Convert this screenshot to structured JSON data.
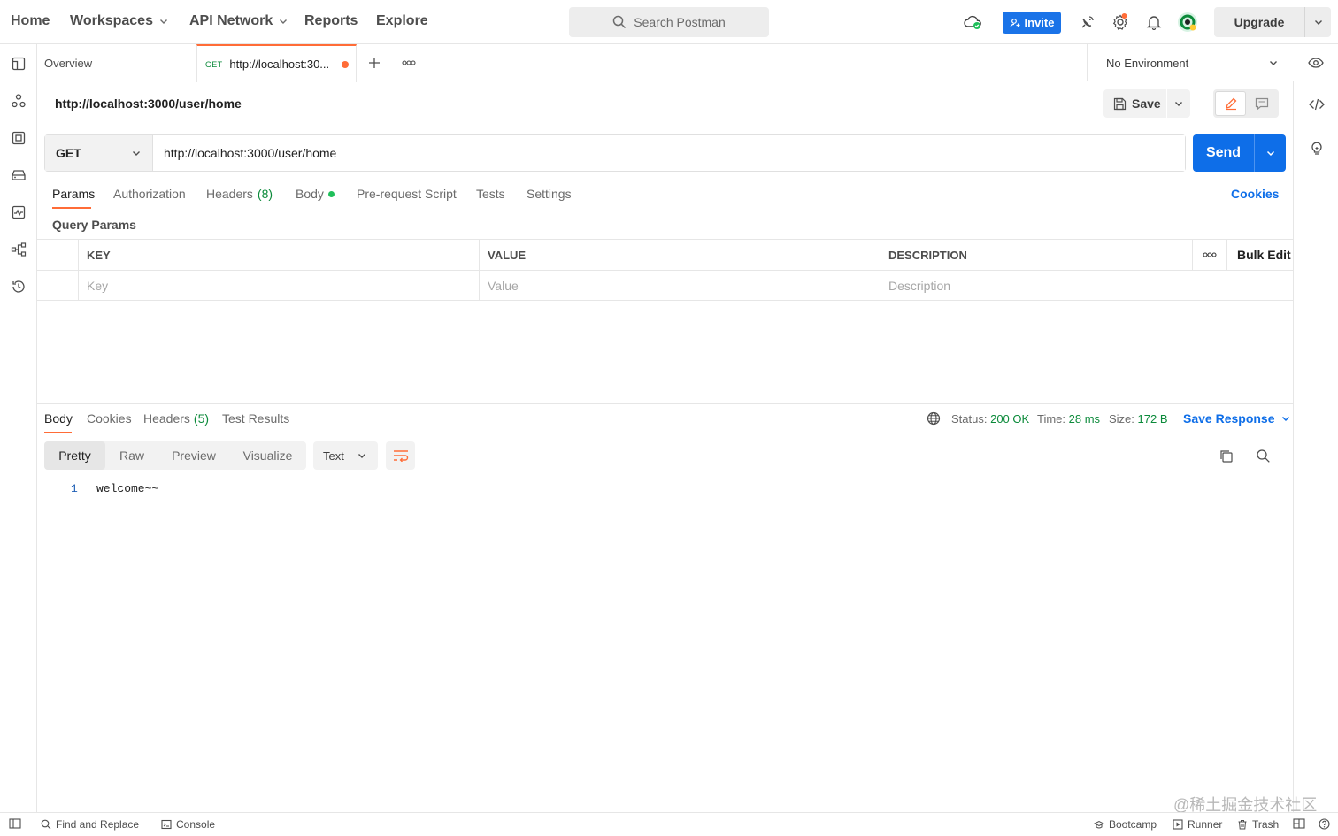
{
  "nav": {
    "home": "Home",
    "workspaces": "Workspaces",
    "api_network": "API Network",
    "reports": "Reports",
    "explore": "Explore",
    "search_placeholder": "Search Postman",
    "invite": "Invite",
    "upgrade": "Upgrade"
  },
  "tabs": {
    "overview": "Overview",
    "active_method": "GET",
    "active_title": "http://localhost:30...",
    "environment": "No Environment"
  },
  "request": {
    "title": "http://localhost:3000/user/home",
    "save": "Save",
    "method": "GET",
    "url": "http://localhost:3000/user/home",
    "send": "Send"
  },
  "request_tabs": {
    "params": "Params",
    "authorization": "Authorization",
    "headers": "Headers",
    "headers_count": "(8)",
    "body": "Body",
    "pre_request": "Pre-request Script",
    "tests": "Tests",
    "settings": "Settings",
    "cookies": "Cookies"
  },
  "query_params": {
    "title": "Query Params",
    "columns": [
      "KEY",
      "VALUE",
      "DESCRIPTION"
    ],
    "placeholders": [
      "Key",
      "Value",
      "Description"
    ],
    "bulk_edit": "Bulk Edit"
  },
  "response": {
    "tabs": {
      "body": "Body",
      "cookies": "Cookies",
      "headers": "Headers",
      "headers_count": "(5)",
      "test_results": "Test Results"
    },
    "status_label": "Status:",
    "status_value": "200 OK",
    "time_label": "Time:",
    "time_value": "28 ms",
    "size_label": "Size:",
    "size_value": "172 B",
    "save_response": "Save Response",
    "views": [
      "Pretty",
      "Raw",
      "Preview",
      "Visualize"
    ],
    "format": "Text",
    "lines": [
      {
        "num": "1",
        "text": "welcome~~"
      }
    ]
  },
  "statusbar": {
    "find_replace": "Find and Replace",
    "console": "Console",
    "bootcamp": "Bootcamp",
    "runner": "Runner",
    "trash": "Trash"
  },
  "watermark": "@稀土掘金技术社区",
  "colors": {
    "accent_orange": "#ff6c37",
    "primary_blue": "#0e6ee8",
    "success_green": "#0b8a3a"
  }
}
